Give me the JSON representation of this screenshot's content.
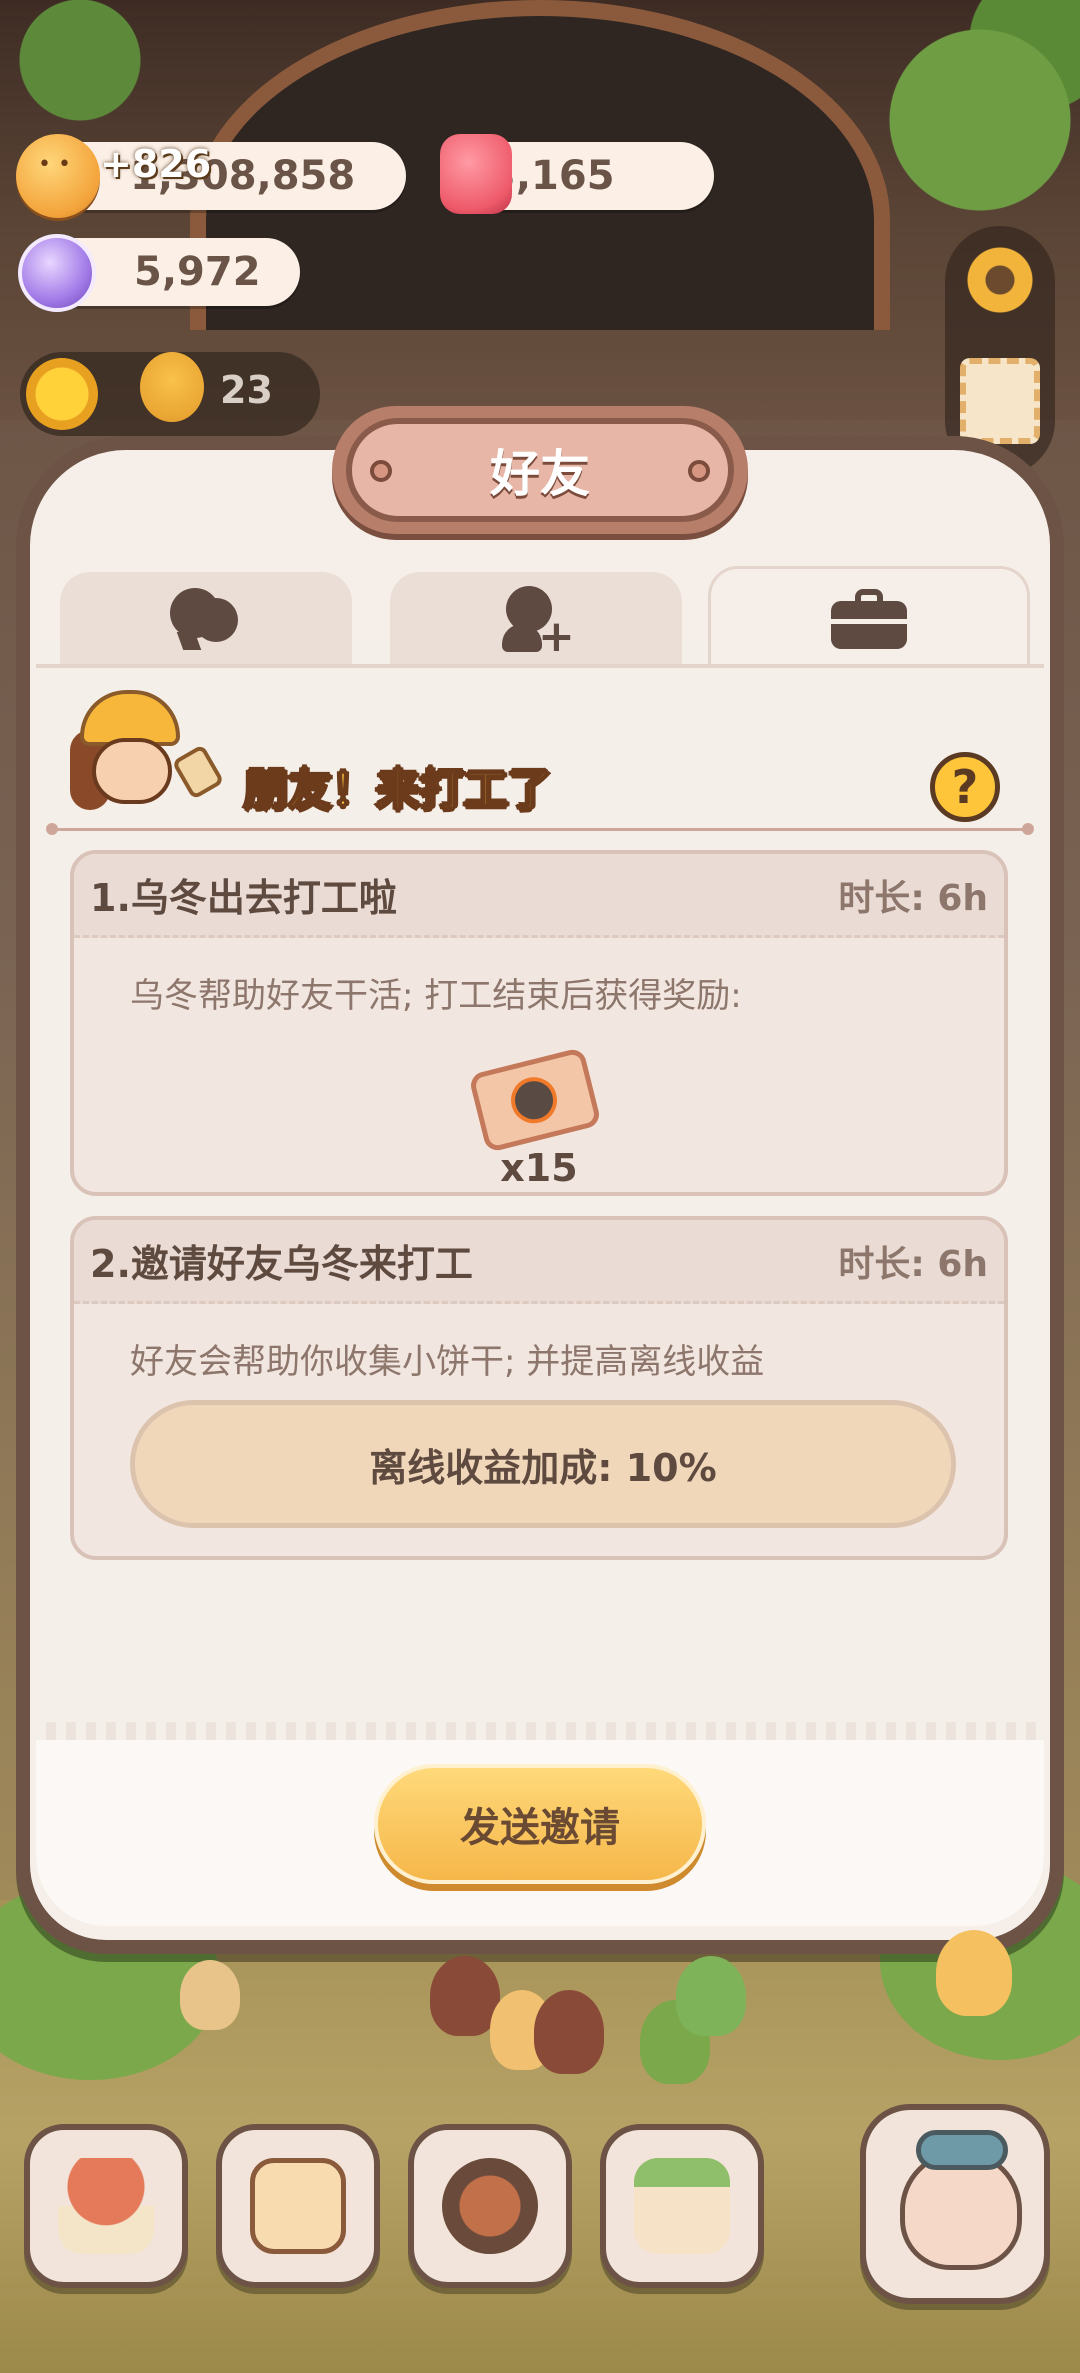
{
  "currencies": {
    "coins": "1,308,858",
    "coins_gain": "+826",
    "gems": "3,165",
    "candy": "5,972"
  },
  "side": {
    "helper_count": "23"
  },
  "dialog": {
    "title": "好友",
    "tabs": [
      {
        "icon": "chat-bubbles-icon"
      },
      {
        "icon": "add-friend-icon"
      },
      {
        "icon": "briefcase-icon",
        "active": true
      }
    ],
    "banner": "朋友！来打工了",
    "help": "?",
    "cards": [
      {
        "title": "1.乌冬出去打工啦",
        "duration": "时长: 6h",
        "desc": "乌冬帮助好友干活; 打工结束后获得奖励:",
        "reward_icon": "ticket-icon",
        "reward_qty": "x15"
      },
      {
        "title": "2.邀请好友乌冬来打工",
        "duration": "时长: 6h",
        "desc": "好友会帮助你收集小饼干; 并提高离线收益",
        "bonus": "离线收益加成: 10%"
      }
    ],
    "send_button": "发送邀请"
  }
}
